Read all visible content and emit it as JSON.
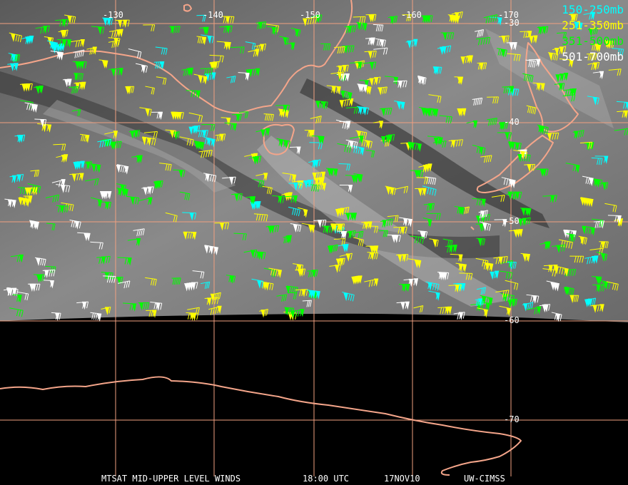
{
  "colors": {
    "grid": "#f0a080",
    "coast": "#f4a58a",
    "cloud": "#9a9a9a",
    "legend_150_250": "#00ffff",
    "legend_251_350": "#ffff00",
    "legend_351_500": "#00ff00",
    "legend_501_700": "#ffffff"
  },
  "longitude_labels": [
    "-130",
    "-140",
    "-150",
    "-160",
    "-170"
  ],
  "latitude_labels": [
    "-30",
    "-40",
    "-50",
    "-60",
    "-70"
  ],
  "legend": [
    {
      "label": "150-250mb",
      "color": "#00ffff"
    },
    {
      "label": "251-350mb",
      "color": "#ffff00"
    },
    {
      "label": "351-500mb",
      "color": "#00ff00"
    },
    {
      "label": "501-700mb",
      "color": "#ffffff"
    }
  ],
  "footer": {
    "product": "MTSAT MID-UPPER LEVEL WINDS",
    "time": "18:00 UTC",
    "date": "17NOV10",
    "source": "UW-CIMSS"
  }
}
